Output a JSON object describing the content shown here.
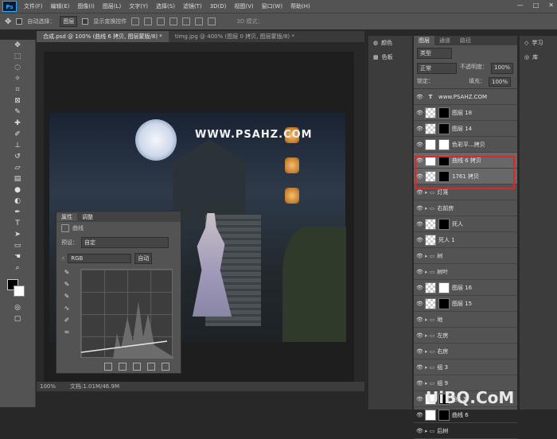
{
  "app": {
    "logo": "Ps"
  },
  "menu": [
    "文件(F)",
    "编辑(E)",
    "图像(I)",
    "图层(L)",
    "文字(Y)",
    "选择(S)",
    "滤镜(T)",
    "3D(D)",
    "视图(V)",
    "窗口(W)",
    "帮助(H)"
  ],
  "window_controls": {
    "minimize": "—",
    "maximize": "□",
    "close": "✕"
  },
  "options_bar": {
    "auto_select_label": "自动选择：",
    "auto_select_value": "图层",
    "show_transform": "显示变换控件",
    "mode_3d": "3D 模式："
  },
  "tabs": [
    {
      "label": "合成.psd @ 100% (曲线 6 拷贝, 图层蒙版/8) *"
    },
    {
      "label": "timg.jpg @ 400% (图层 0 拷贝, 图层蒙版/8) *"
    }
  ],
  "watermark": "WWW.PSAHZ.COM",
  "properties": {
    "tab1": "属性",
    "tab2": "调整",
    "title": "曲线",
    "preset_label": "预设：",
    "preset_value": "自定",
    "channel": "RGB",
    "auto": "自动"
  },
  "dock1": {
    "color": "颜色",
    "swatches": "色板"
  },
  "dock2": {
    "learn": "学习",
    "sound": "库"
  },
  "layers_panel": {
    "tabs": [
      "图层",
      "通道",
      "路径"
    ],
    "kind": "类型",
    "blend": "正常",
    "opacity_label": "不透明度：",
    "opacity": "100%",
    "lock_label": "锁定：",
    "fill_label": "填充：",
    "fill": "100%",
    "layers": [
      {
        "name": "www.PSAHZ.COM",
        "type": "text"
      },
      {
        "name": "图层 18",
        "type": "mask"
      },
      {
        "name": "图层 14",
        "type": "mask"
      },
      {
        "name": "色彩平...拷贝",
        "type": "adj"
      },
      {
        "name": "曲线 6 拷贝",
        "type": "adj"
      },
      {
        "name": "1761 拷贝",
        "type": "mask"
      },
      {
        "name": "灯笼",
        "type": "group"
      },
      {
        "name": "右前房",
        "type": "group"
      },
      {
        "name": "死人",
        "type": "mask"
      },
      {
        "name": "死人 1",
        "type": "plain"
      },
      {
        "name": "树",
        "type": "group"
      },
      {
        "name": "树叶",
        "type": "group"
      },
      {
        "name": "图层 16",
        "type": "mask"
      },
      {
        "name": "图层 15",
        "type": "mask"
      },
      {
        "name": "地",
        "type": "group"
      },
      {
        "name": "左房",
        "type": "group"
      },
      {
        "name": "右房",
        "type": "group"
      },
      {
        "name": "组 3",
        "type": "group"
      },
      {
        "name": "组 9",
        "type": "group"
      },
      {
        "name": "色...3",
        "type": "adj"
      },
      {
        "name": "曲线 6",
        "type": "adj"
      },
      {
        "name": "后树",
        "type": "group"
      }
    ]
  },
  "status": {
    "zoom": "100%",
    "doc": "文档:1.01M/46.9M"
  },
  "site_logo": "UiBQ.CoM"
}
